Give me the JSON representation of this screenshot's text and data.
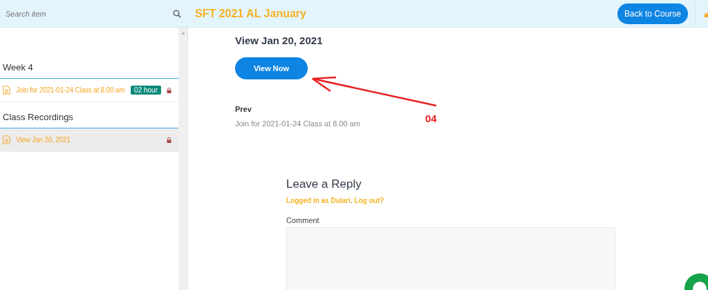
{
  "header": {
    "search": {
      "placeholder": "Search item"
    },
    "course_title": "SFT 2021 AL January",
    "back_button": "Back to Course"
  },
  "sidebar": {
    "sections": [
      {
        "title": "Week 4",
        "items": [
          {
            "label": "Join for 2021-01-24 Class at 8.00 am",
            "badge": "02 hour",
            "locked": true,
            "selected": false
          }
        ]
      },
      {
        "title": "Class Recordings",
        "items": [
          {
            "label": "View Jan 20, 2021",
            "locked": true,
            "selected": true
          }
        ]
      }
    ]
  },
  "lesson": {
    "title": "View Jan 20, 2021",
    "view_button": "View Now",
    "prev_label": "Prev",
    "prev_link": "Join for 2021-01-24 Class at 8.00 am"
  },
  "annotation": {
    "label": "04"
  },
  "reply": {
    "title": "Leave a Reply",
    "logged_in_link": "Logged in as Dulari",
    "separator": ".",
    "logout_link": "Log out?",
    "comment_label": "Comment"
  }
}
